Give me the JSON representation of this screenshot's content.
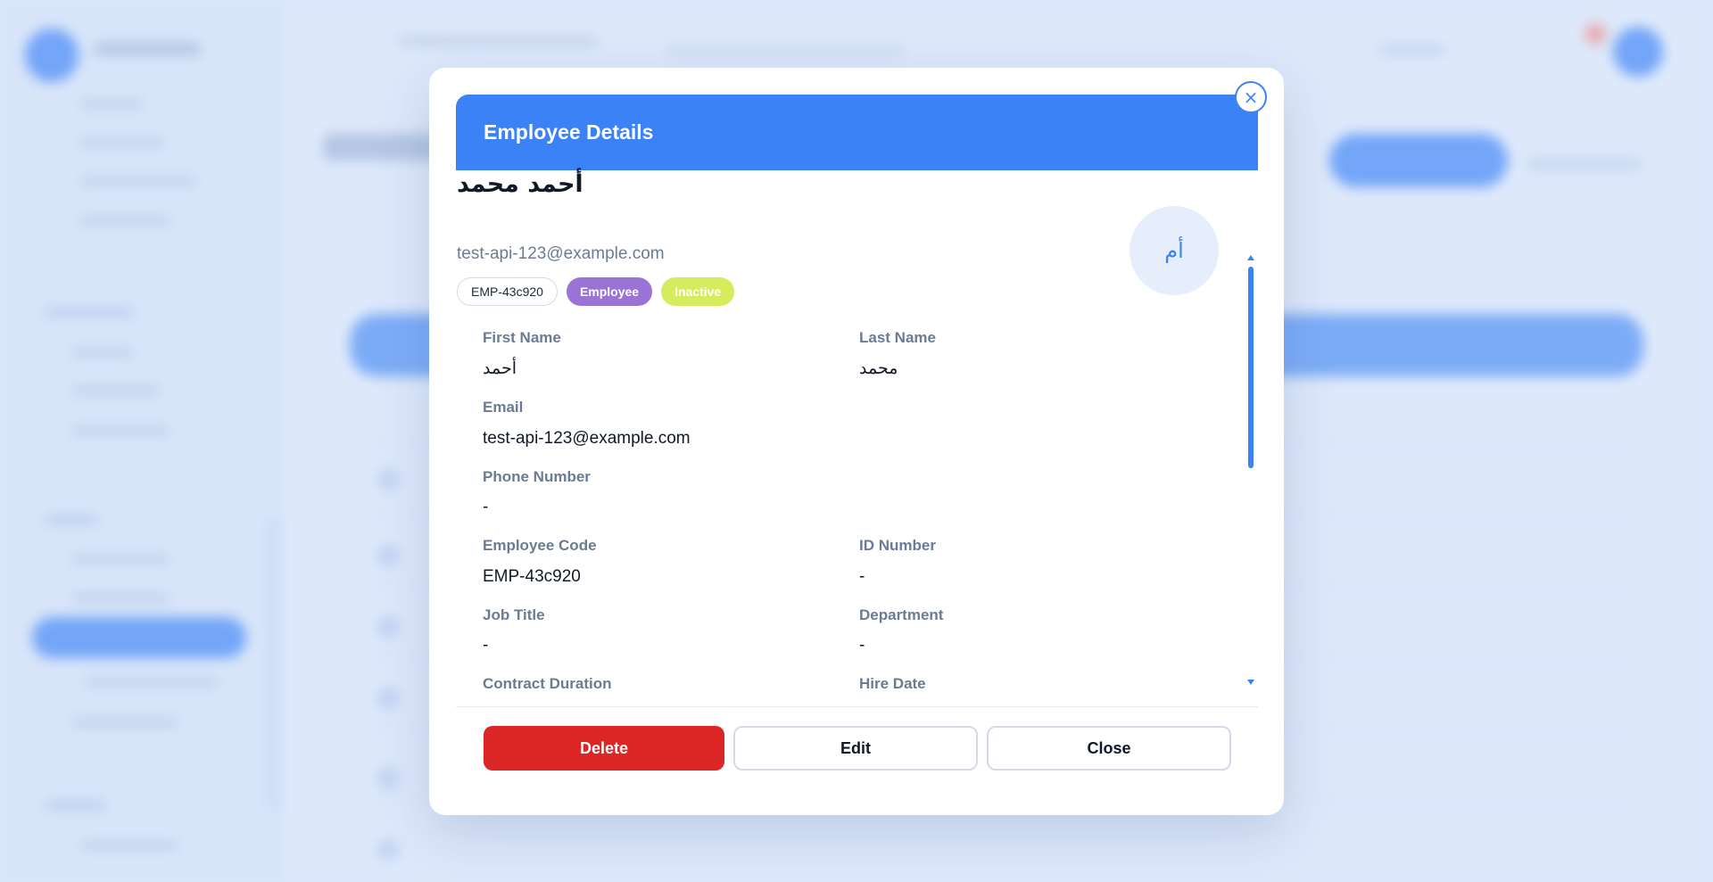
{
  "modal": {
    "title": "Employee Details",
    "close_icon": "×"
  },
  "profile": {
    "name": "أحمد محمد",
    "email": "test-api-123@example.com",
    "avatar_initials": "أم",
    "badges": {
      "code": "EMP-43c920",
      "role": "Employee",
      "status": "Inactive"
    }
  },
  "fields": {
    "first_name": {
      "label": "First Name",
      "value": "أحمد"
    },
    "last_name": {
      "label": "Last Name",
      "value": "محمد"
    },
    "email": {
      "label": "Email",
      "value": "test-api-123@example.com"
    },
    "phone": {
      "label": "Phone Number",
      "value": "-"
    },
    "employee_code": {
      "label": "Employee Code",
      "value": "EMP-43c920"
    },
    "id_number": {
      "label": "ID Number",
      "value": "-"
    },
    "job_title": {
      "label": "Job Title",
      "value": "-"
    },
    "department": {
      "label": "Department",
      "value": "-"
    },
    "contract_duration": {
      "label": "Contract Duration"
    },
    "hire_date": {
      "label": "Hire Date"
    }
  },
  "footer": {
    "delete_label": "Delete",
    "edit_label": "Edit",
    "close_label": "Close"
  },
  "colors": {
    "primary": "#3b82f6",
    "danger": "#dc2626",
    "role_badge": "#9b72d6",
    "status_badge": "#d7ec5c"
  }
}
